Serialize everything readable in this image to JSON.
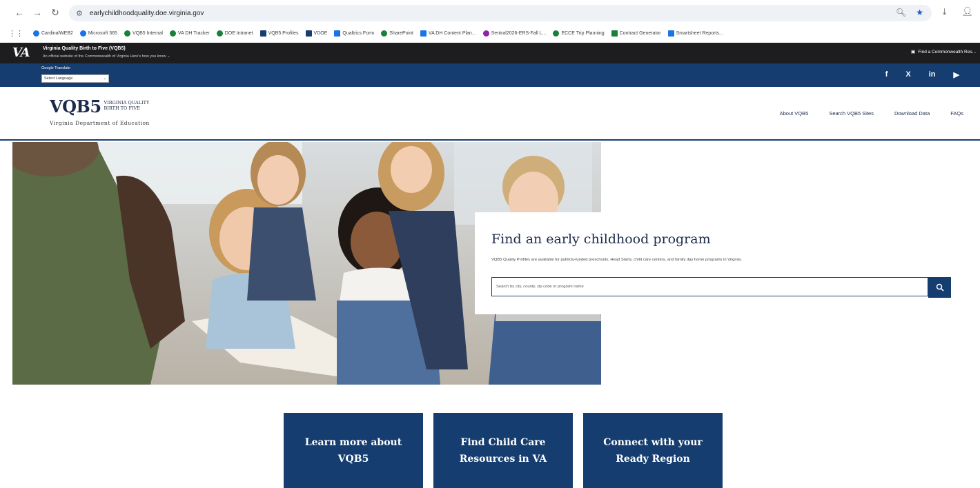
{
  "browser": {
    "back_icon": "back-arrow-icon",
    "forward_icon": "forward-arrow-icon",
    "reload_icon": "reload-icon",
    "url": "earlychildhoodquality.doe.virginia.gov",
    "bookmarks": [
      {
        "label": "CardinalWEB2",
        "color": "#1a73e8"
      },
      {
        "label": "Microsoft 365",
        "color": "#1a73e8"
      },
      {
        "label": "VQB5 Internal",
        "color": "#188038"
      },
      {
        "label": "VA DH Tracker",
        "color": "#188038"
      },
      {
        "label": "DOE Intranet",
        "color": "#188038"
      },
      {
        "label": "VQB5 Profiles",
        "color": "#153d6f"
      },
      {
        "label": "VDOE",
        "color": "#153d6f"
      },
      {
        "label": "Qualtrics Form",
        "color": "#1a73e8"
      },
      {
        "label": "SharePoint",
        "color": "#188038"
      },
      {
        "label": "VA DH Content Plan...",
        "color": "#1a73e8"
      },
      {
        "label": "Sentral2026-ERS-Fall L...",
        "color": "#8e24aa"
      },
      {
        "label": "ECCE Trip Planning",
        "color": "#188038"
      },
      {
        "label": "Contract Generator",
        "color": "#188038"
      },
      {
        "label": "Smartsheet Reports...",
        "color": "#1a73e8"
      }
    ]
  },
  "gov_banner": {
    "logo": "VA",
    "title": "Virginia Quality Birth to Five (VQB5)",
    "subtitle": "An official website of the Commonwealth of Virginia  Here's how you know ⌄",
    "right_link": "Find a Commonwealth Res..."
  },
  "blue_bar": {
    "translate_label": "Google Translate",
    "language_select": "Select Language",
    "socials": [
      "f",
      "X",
      "in",
      "▶"
    ]
  },
  "header": {
    "logo_main": "VQB5",
    "logo_side_line1": "VIRGINIA QUALITY",
    "logo_side_line2": "BIRTH TO FIVE",
    "department": "Virginia Department of Education",
    "nav": [
      "About VQB5",
      "Search VQB5 Sites",
      "Download Data",
      "FAQs"
    ]
  },
  "hero_card": {
    "title": "Find an early childhood program",
    "description": "VQB5 Quality Profiles are available for publicly-funded preschools, Head Starts, child care centers, and family day home programs in Virginia.",
    "search_placeholder": "Search by city, county, zip code or program name",
    "search_icon": "search-icon"
  },
  "tiles": [
    {
      "line1": "Learn more about",
      "line2": "VQB5"
    },
    {
      "line1": "Find Child Care",
      "line2": "Resources in VA"
    },
    {
      "line1": "Connect with your",
      "line2": "Ready Region"
    }
  ],
  "colors": {
    "brand_navy": "#153d6f",
    "banner_black": "#1d1d1f"
  }
}
